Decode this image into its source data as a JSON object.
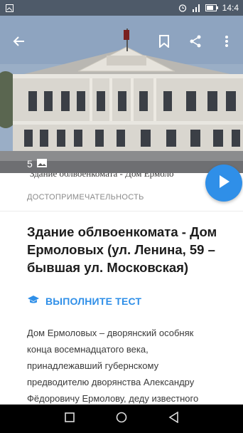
{
  "status_bar": {
    "time": "14:4",
    "icons": [
      "gallery-notification-icon",
      "alarm-icon",
      "signal-icon",
      "battery-icon"
    ]
  },
  "toolbar": {
    "icons": [
      "back-arrow-icon",
      "bookmark-icon",
      "share-icon",
      "more-vert-icon"
    ]
  },
  "hero": {
    "photo_count": "5",
    "caption_partial": "Здание облвоенкомата - Дом Ермоло"
  },
  "fab": {
    "icon": "play-icon",
    "color": "#2f8fe8"
  },
  "content": {
    "category": "ДОСТОПРИМЕЧАТЕЛЬНОСТЬ",
    "title": "Здание облвоенкомата - Дом Ермоловых (ул. Ленина, 59 – бывшая ул. Московская)",
    "quiz_label": "ВЫПОЛНИТЕ ТЕСТ",
    "description": "Дом Ермоловых – дворянский особняк конца восемнадцатого века, принадлежавший губернскому предводителю дворянства Александру Фёдоровичу Ермолову, деду известного"
  },
  "nav_bar": {
    "icons": [
      "square-recents-icon",
      "circle-home-icon",
      "triangle-back-icon"
    ]
  },
  "colors": {
    "accent": "#2f8fe8"
  }
}
